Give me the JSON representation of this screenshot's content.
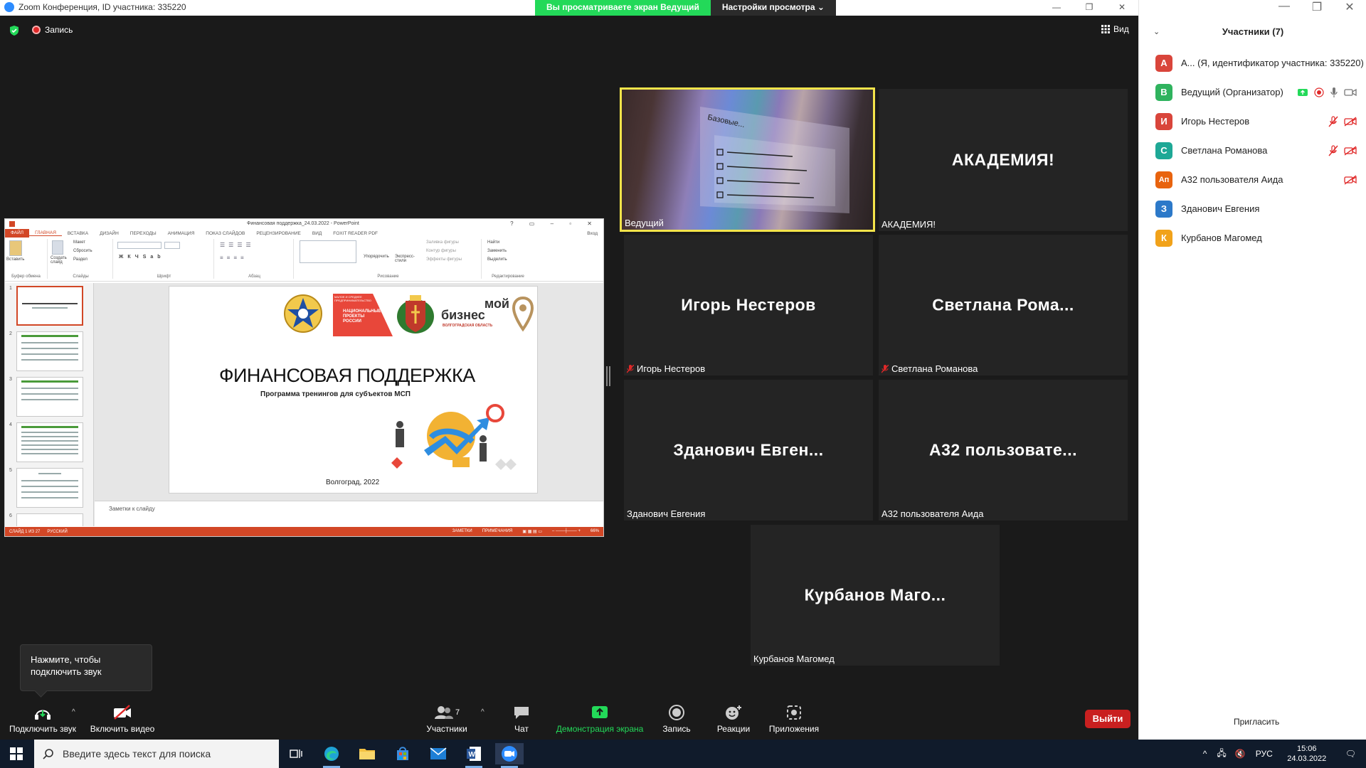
{
  "window": {
    "title": "Zoom Конференция, ID участника: 335220",
    "share_banner_text": "Вы просматриваете экран Ведущий",
    "view_options_label": "Настройки просмотра",
    "controls": [
      "—",
      "❐",
      "✕"
    ]
  },
  "stage": {
    "recording_label": "Запись",
    "view_label": "Вид"
  },
  "powerpoint": {
    "title": "Финансовая поддержка_24.03.2022 - PowerPoint",
    "tabs": [
      "ФАЙЛ",
      "ГЛАВНАЯ",
      "ВСТАВКА",
      "ДИЗАЙН",
      "ПЕРЕХОДЫ",
      "АНИМАЦИЯ",
      "ПОКАЗ СЛАЙДОВ",
      "РЕЦЕНЗИРОВАНИЕ",
      "ВИД",
      "FOXIT READER PDF"
    ],
    "account_label": "Вход",
    "ribbon_groups": [
      "Буфер обмена",
      "Слайды",
      "Шрифт",
      "Абзац",
      "Рисование",
      "Редактирование"
    ],
    "ribbon_buttons": {
      "paste": "Вставить",
      "new_slide": "Создать слайд",
      "layout": "Макет",
      "reset": "Сбросить",
      "section": "Раздел",
      "arrange": "Упорядочить",
      "quick_styles": "Экспресс-стили",
      "shape_fill": "Заливка фигуры",
      "shape_outline": "Контур фигуры",
      "shape_effects": "Эффекты фигуры",
      "find": "Найти",
      "replace": "Заменить",
      "select": "Выделить"
    },
    "thumb_numbers": [
      "1",
      "2",
      "3",
      "4",
      "5",
      "6"
    ],
    "slide": {
      "title": "ФИНАНСОВАЯ ПОДДЕРЖКА",
      "subtitle": "Программа тренингов для субъектов МСП",
      "city_year": "Волгоград, 2022",
      "logo_np_text": "НАЦИОНАЛЬНЫЕ ПРОЕКТЫ РОССИИ",
      "logo_np_small": "МАЛОЕ И СРЕДНЕЕ ПРЕДПРИНИМАТЕЛЬСТВО",
      "logo_mb_line1": "мой",
      "logo_mb_line2": "бизнес",
      "logo_mb_region": "ВОЛГОГРАДСКАЯ ОБЛАСТЬ"
    },
    "notes_placeholder": "Заметки к слайду",
    "status": {
      "slide_counter": "СЛАЙД 1 ИЗ 27",
      "language": "РУССКИЙ",
      "notes": "ЗАМЕТКИ",
      "comments": "ПРИМЕЧАНИЯ",
      "zoom": "66%"
    }
  },
  "tiles": [
    {
      "id": "host",
      "name": "Ведущий",
      "big": "",
      "muted": false
    },
    {
      "id": "academy",
      "name": "АКАДЕМИЯ!",
      "big": "АКАДЕМИЯ!",
      "muted": false
    },
    {
      "id": "nesterov",
      "name": "Игорь Нестеров",
      "big": "Игорь Нестеров",
      "muted": true
    },
    {
      "id": "romanova",
      "name": "Светлана Романова",
      "big": "Светлана  Рома...",
      "muted": true
    },
    {
      "id": "zdanovich",
      "name": "Зданович Евгения",
      "big": "Зданович  Евген...",
      "muted": false
    },
    {
      "id": "a32",
      "name": "А32 пользователя Аида",
      "big": "А32  пользовате...",
      "muted": false
    },
    {
      "id": "kurbanov",
      "name": "Курбанов Магомед",
      "big": "Курбанов  Маго...",
      "muted": false
    }
  ],
  "host_screen_text": "Базовые...",
  "tooltip": {
    "line1": "Нажмите, чтобы",
    "line2": "подключить звук"
  },
  "toolbar": {
    "audio": "Подключить звук",
    "video": "Включить видео",
    "participants": "Участники",
    "participants_count": "7",
    "chat": "Чат",
    "share": "Демонстрация экрана",
    "record": "Запись",
    "reactions": "Реакции",
    "apps": "Приложения",
    "leave": "Выйти"
  },
  "panel": {
    "title": "Участники (7)",
    "invite": "Пригласить",
    "participants": [
      {
        "initials": "А",
        "name": "А... (Я, идентификатор участника: 335220)",
        "color": "#d9453b"
      },
      {
        "initials": "В",
        "name": "Ведущий (Организатор)",
        "color": "#2fb35e"
      },
      {
        "initials": "И",
        "name": "Игорь Нестеров",
        "color": "#d9453b"
      },
      {
        "initials": "С",
        "name": "Светлана Романова",
        "color": "#1ea896"
      },
      {
        "initials": "Ап",
        "name": "А32 пользователя Аида",
        "color": "#e8630e"
      },
      {
        "initials": "З",
        "name": "Зданович Евгения",
        "color": "#2c79c9"
      },
      {
        "initials": "К",
        "name": "Курбанов Магомед",
        "color": "#f1a21a"
      }
    ]
  },
  "taskbar": {
    "search_placeholder": "Введите здесь текст для поиска",
    "language": "РУС",
    "time": "15:06",
    "date": "24.03.2022",
    "apps": [
      "task-view",
      "edge",
      "file-explorer",
      "store",
      "mail",
      "word",
      "zoom"
    ]
  },
  "colors": {
    "share_green": "#23d959",
    "leave_red": "#c92020",
    "active_speaker": "#f4e44a",
    "ppt_orange": "#d24726"
  }
}
